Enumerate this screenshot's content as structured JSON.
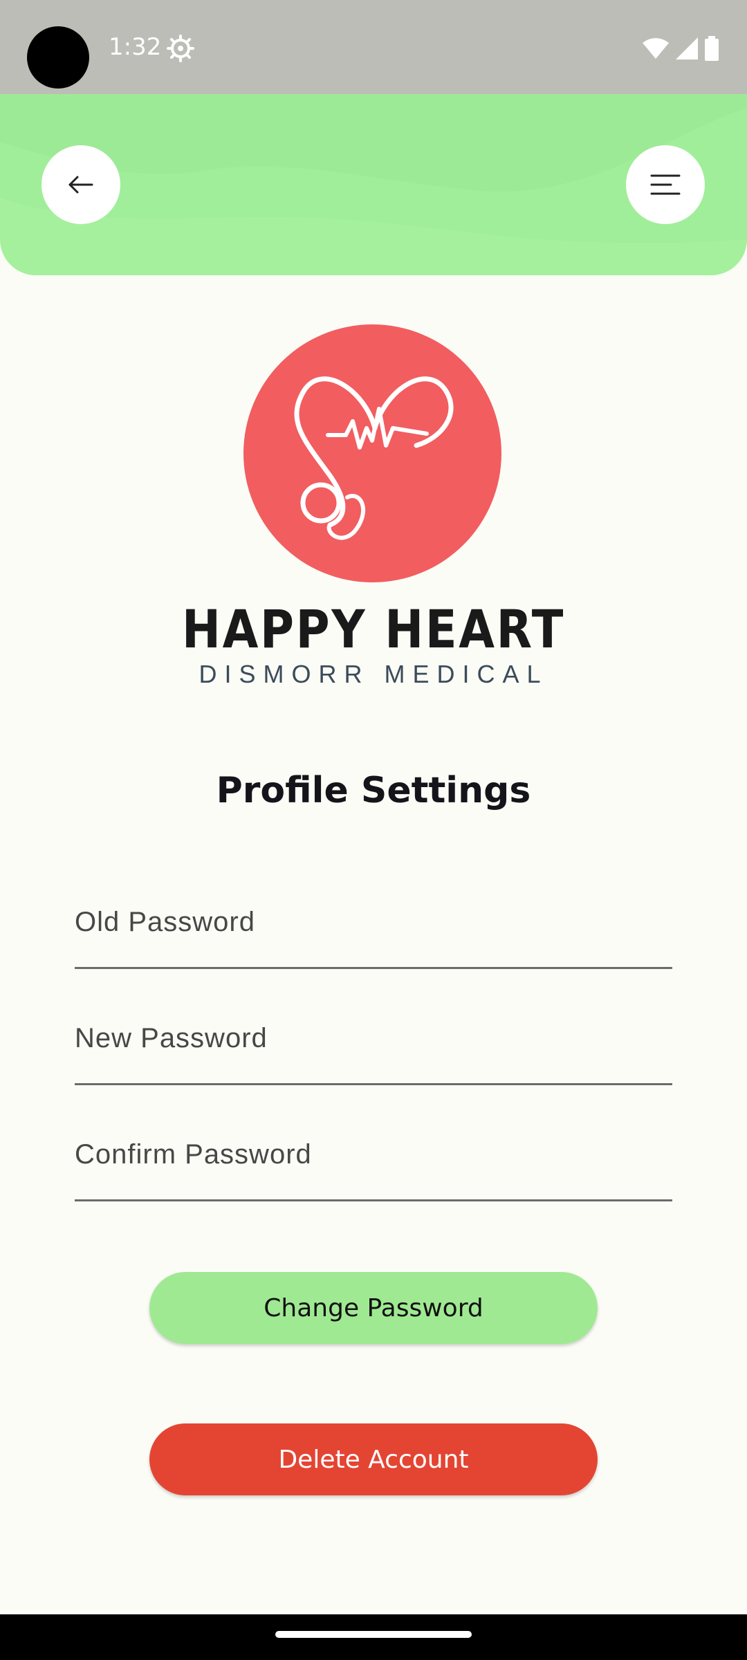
{
  "status_bar": {
    "time": "1:32",
    "icons": [
      "settings-gear-icon",
      "wifi-icon",
      "cell-signal-icon",
      "battery-icon"
    ]
  },
  "header": {
    "back_icon": "arrow-left-icon",
    "menu_icon": "menu-lines-icon",
    "color": "#a0ee99"
  },
  "logo": {
    "brand_name": "HAPPY HEART",
    "brand_sub": "DISMORR MEDICAL",
    "circle_color": "#f25d60"
  },
  "page": {
    "title": "Profile Settings"
  },
  "form": {
    "old_password": {
      "placeholder": "Old Password",
      "value": ""
    },
    "new_password": {
      "placeholder": "New Password",
      "value": ""
    },
    "confirm_password": {
      "placeholder": "Confirm Password",
      "value": ""
    }
  },
  "actions": {
    "change_password_label": "Change Password",
    "delete_account_label": "Delete Account",
    "change_color": "#a0e993",
    "delete_color": "#e44533"
  }
}
